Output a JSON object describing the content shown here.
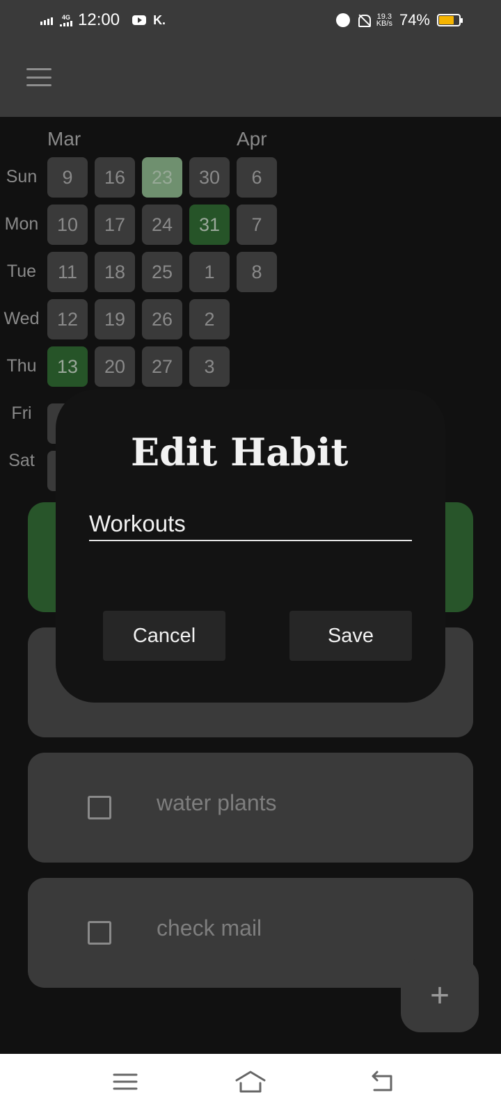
{
  "status_bar": {
    "network": "4G",
    "time": "12:00",
    "speed_value": "19.3",
    "speed_unit": "KB/s",
    "battery": "74%",
    "battery_level": 0.74,
    "icons": [
      "signal-icon",
      "youtube-icon",
      "app-k-icon",
      "alarm-icon",
      "bell-off-icon",
      "battery-icon"
    ]
  },
  "app_bar": {
    "icon": "hamburger-menu-icon"
  },
  "heatmap": {
    "months": [
      "Mar",
      "Apr"
    ],
    "days": [
      "Sun",
      "Mon",
      "Tue",
      "Wed",
      "Thu",
      "Fri",
      "Sat"
    ],
    "weeks": [
      [
        "9",
        "10",
        "11",
        "12",
        "13",
        "",
        ""
      ],
      [
        "16",
        "17",
        "18",
        "19",
        "20",
        "",
        ""
      ],
      [
        "23",
        "24",
        "25",
        "26",
        "27",
        "",
        ""
      ],
      [
        "30",
        "31",
        "1",
        "2",
        "3",
        "",
        ""
      ],
      [
        "6",
        "7",
        "8",
        "",
        "",
        "",
        ""
      ]
    ],
    "completed": [
      "13",
      "31"
    ],
    "today": "23",
    "colors": {
      "completed": "#265428",
      "today": "#6f906f",
      "empty": "#3a3a3a"
    }
  },
  "habits": [
    {
      "label": "water plants"
    },
    {
      "label": "check mail"
    }
  ],
  "fab": {
    "label": "+"
  },
  "dialog": {
    "title": "Edit Habit",
    "input_value": "Workouts",
    "cancel_label": "Cancel",
    "save_label": "Save"
  },
  "nav_bar": {
    "icons": [
      "recents-icon",
      "home-icon",
      "back-icon"
    ]
  }
}
